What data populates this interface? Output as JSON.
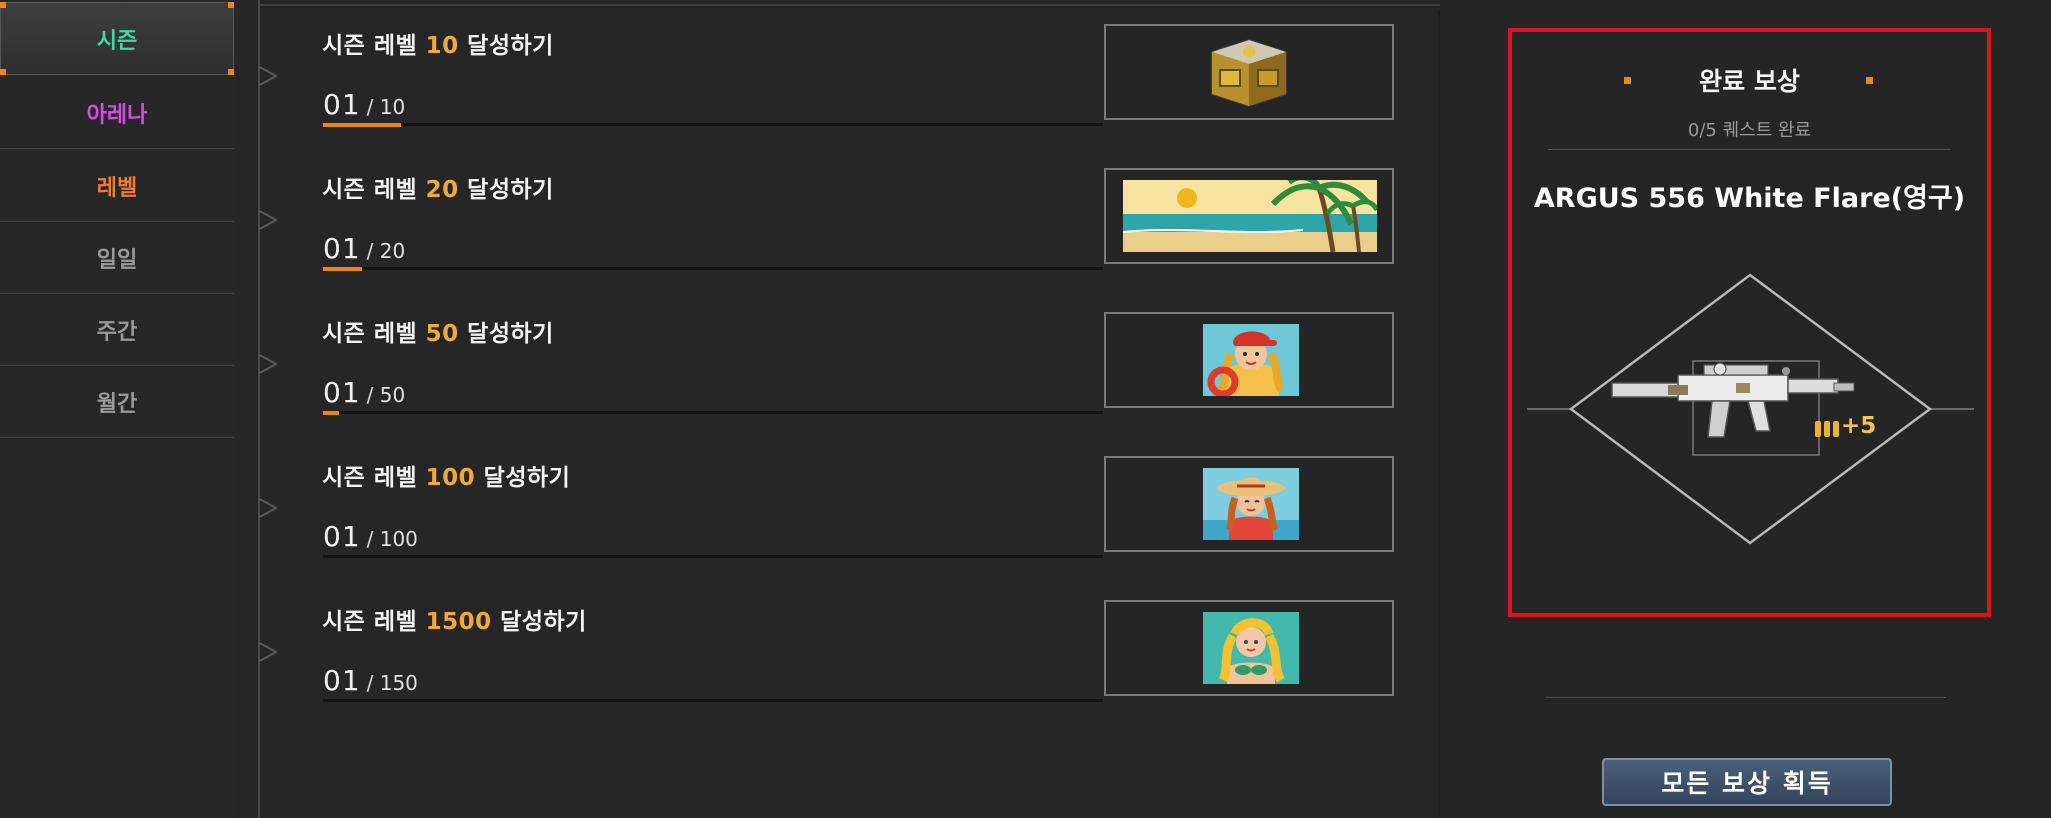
{
  "sidebar": {
    "items": [
      {
        "label": "시즌",
        "color": "#3fd9a3"
      },
      {
        "label": "아레나",
        "color": "#d24de0"
      },
      {
        "label": "레벨",
        "color": "#f07a3a"
      },
      {
        "label": "일일",
        "color": "#9a9a9a"
      },
      {
        "label": "주간",
        "color": "#9a9a9a"
      },
      {
        "label": "월간",
        "color": "#9a9a9a"
      }
    ]
  },
  "quests": [
    {
      "prefix": "시즌 레벨 ",
      "num": "10",
      "suffix": " 달성하기",
      "current": "01",
      "total": "/ 10",
      "progress": 0.1,
      "reward_icon": "golden-crate-icon"
    },
    {
      "prefix": "시즌 레벨 ",
      "num": "20",
      "suffix": " 달성하기",
      "current": "01",
      "total": "/ 20",
      "progress": 0.05,
      "reward_icon": "beach-banner-icon"
    },
    {
      "prefix": "시즌 레벨 ",
      "num": "50",
      "suffix": " 달성하기",
      "current": "01",
      "total": "/ 50",
      "progress": 0.02,
      "reward_icon": "lifeguard-girl-icon"
    },
    {
      "prefix": "시즌 레벨 ",
      "num": "100",
      "suffix": " 달성하기",
      "current": "01",
      "total": "/ 100",
      "progress": 0.0,
      "reward_icon": "sunhat-girl-icon"
    },
    {
      "prefix": "시즌 레벨 ",
      "num": "1500",
      "suffix": " 달성하기",
      "current": "01",
      "total": "/ 150",
      "progress": 0.0,
      "reward_icon": "mermaid-icon"
    }
  ],
  "reward": {
    "title": "완료 보상",
    "subtitle": "0/5 퀘스트 완료",
    "item_name": "ARGUS 556 White Flare(영구)",
    "ammo_bonus": "+5",
    "button_label": "모든 보상 획득"
  },
  "colors": {
    "accent": "#e88a1a",
    "highlight_number": "#f2a93a",
    "frame_red": "#d9141d"
  }
}
